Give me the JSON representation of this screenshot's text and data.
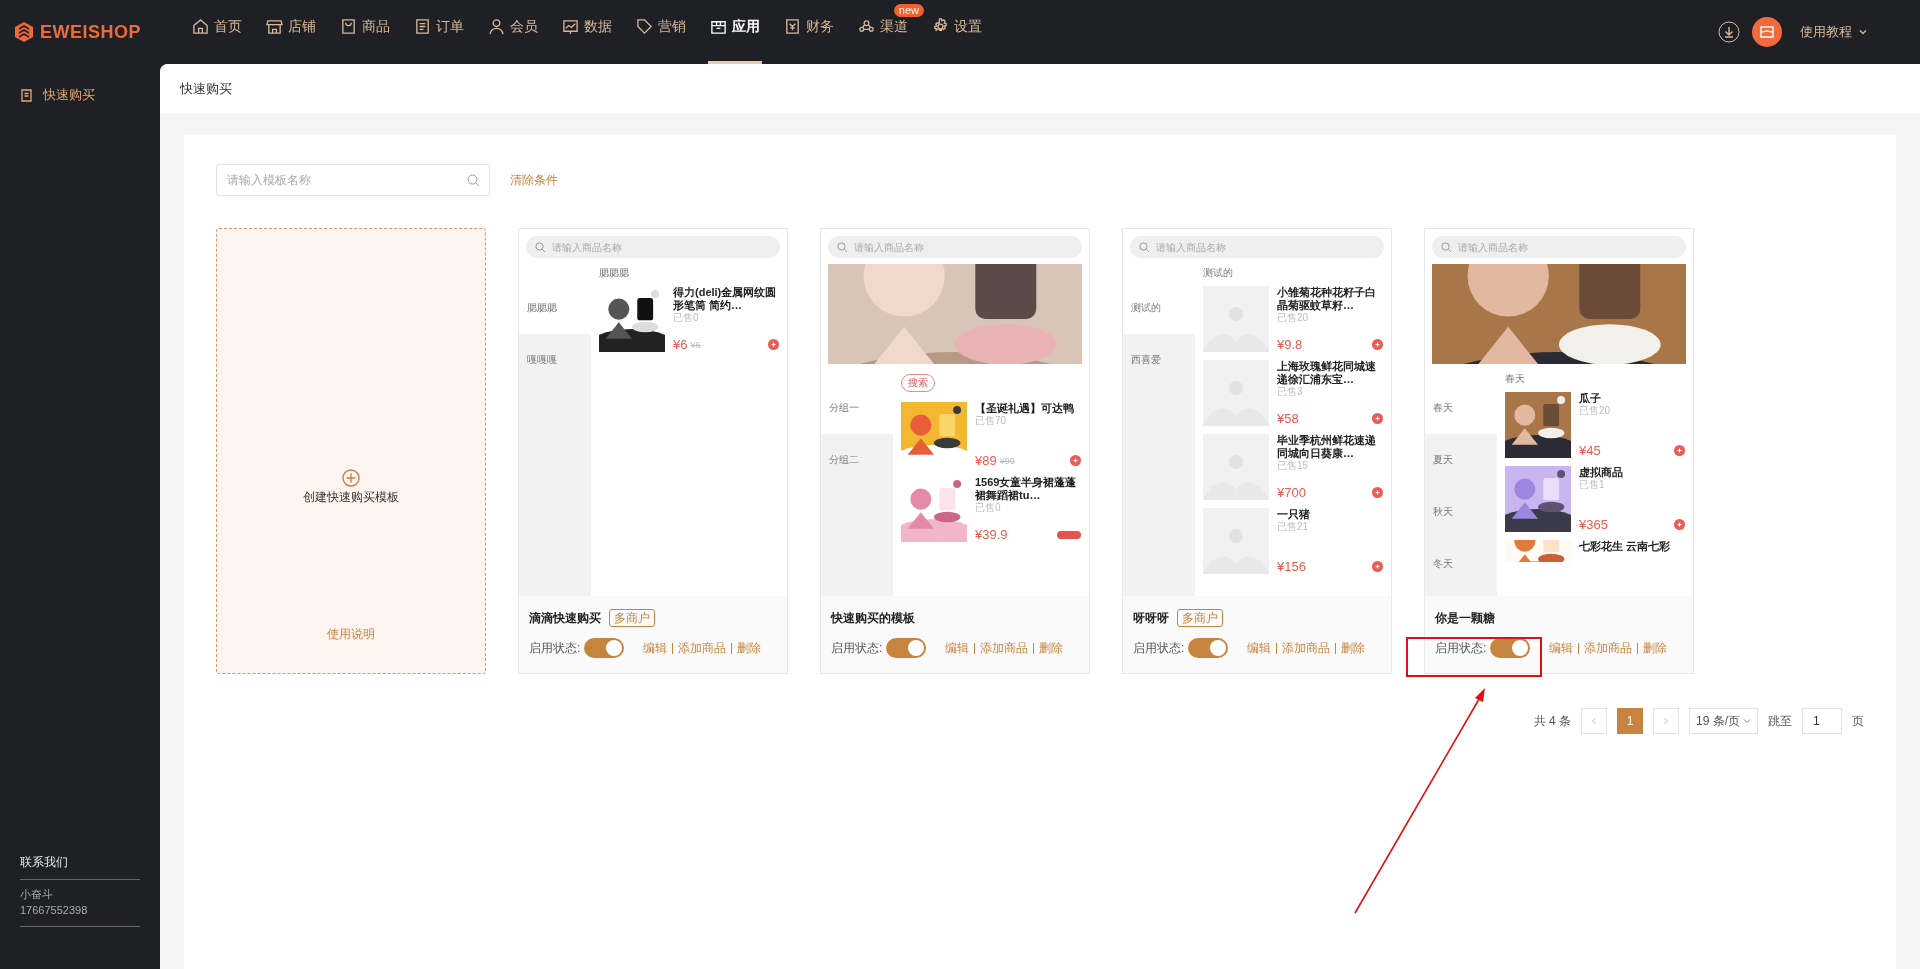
{
  "top_nav": {
    "logo": "EWEISHOP",
    "items": [
      {
        "label": "首页",
        "selected": false
      },
      {
        "label": "店铺",
        "selected": false
      },
      {
        "label": "商品",
        "selected": false
      },
      {
        "label": "订单",
        "selected": false
      },
      {
        "label": "会员",
        "selected": false
      },
      {
        "label": "数据",
        "selected": false
      },
      {
        "label": "营销",
        "selected": false
      },
      {
        "label": "应用",
        "selected": true
      },
      {
        "label": "财务",
        "selected": false
      },
      {
        "label": "渠道",
        "selected": false,
        "badge": "new"
      },
      {
        "label": "设置",
        "selected": false
      }
    ],
    "tutorial": "使用教程"
  },
  "sidebar": {
    "items": [
      {
        "label": "快速购买",
        "selected": true
      }
    ],
    "contact": {
      "title": "联系我们",
      "name": "小奋斗",
      "phone": "17667552398"
    }
  },
  "breadcrumb": "快速购买",
  "filter": {
    "placeholder": "请输入模板名称",
    "clear": "清除条件"
  },
  "create_card": {
    "label": "创建快速购买模板",
    "help": "使用说明"
  },
  "templates": [
    {
      "name": "滴滴快速购买",
      "tag": "多商户",
      "status_label": "启用状态:",
      "enabled": true,
      "actions": [
        "编辑",
        "添加商品",
        "删除"
      ],
      "preview": {
        "search_placeholder": "请输入商品名称",
        "categories": [
          {
            "label": "腮腮腮",
            "selected": true
          },
          {
            "label": "嘎嘎嘎",
            "selected": false
          }
        ],
        "heading": "腮腮腮",
        "products": [
          {
            "name": "得力(deli)金属网纹圆形笔筒 简约…",
            "sold": "已售0",
            "price": "¥6",
            "old_price": "¥6"
          }
        ]
      }
    },
    {
      "name": "快速购买的模板",
      "status_label": "启用状态:",
      "enabled": true,
      "actions": [
        "编辑",
        "添加商品",
        "删除"
      ],
      "preview": {
        "search_placeholder": "请输入商品名称",
        "search_button": "搜索",
        "categories": [
          {
            "label": "分组一",
            "selected": true
          },
          {
            "label": "分组二",
            "selected": false
          }
        ],
        "products": [
          {
            "name": "【圣诞礼遇】可达鸭",
            "sold": "已售70",
            "price": "¥89",
            "old_price": "¥99"
          },
          {
            "kind": "spec",
            "name": "1569女童半身裙蓬蓬裙舞蹈裙tu…",
            "sold": "已售0",
            "price": "¥39.9"
          }
        ]
      }
    },
    {
      "name": "呀呀呀",
      "tag": "多商户",
      "status_label": "启用状态:",
      "enabled": true,
      "actions": [
        "编辑",
        "添加商品",
        "删除"
      ],
      "preview": {
        "search_placeholder": "请输入商品名称",
        "categories": [
          {
            "label": "测试的",
            "selected": true
          },
          {
            "label": "西喜爱",
            "selected": false
          }
        ],
        "heading": "测试的",
        "products": [
          {
            "kind": "blank",
            "name": "小雏菊花种花籽子白晶菊驱蚊草籽…",
            "sold": "已售20",
            "price": "¥9.8"
          },
          {
            "kind": "blank",
            "name": "上海玫瑰鲜花同城速递徐汇浦东宝…",
            "sold": "已售3",
            "price": "¥58"
          },
          {
            "kind": "blank",
            "name": "毕业季杭州鲜花速递同城向日葵康…",
            "sold": "已售15",
            "price": "¥700"
          },
          {
            "kind": "blank",
            "name": "一只猪",
            "sold": "已售21",
            "price": "¥156"
          }
        ]
      }
    },
    {
      "name": "你是一颗糖",
      "status_label": "启用状态:",
      "enabled": true,
      "actions": [
        "编辑",
        "添加商品",
        "删除"
      ],
      "preview": {
        "search_placeholder": "请输入商品名称",
        "categories": [
          {
            "label": "春天",
            "selected": true
          },
          {
            "label": "夏天",
            "selected": false
          },
          {
            "label": "秋天",
            "selected": false
          },
          {
            "label": "冬天",
            "selected": false
          }
        ],
        "heading": "春天",
        "products": [
          {
            "name": "瓜子",
            "sold": "已售20",
            "price": "¥45"
          },
          {
            "name": "虚拟商品",
            "sold": "已售1",
            "price": "¥365"
          },
          {
            "kind": "cut",
            "name": "七彩花生 云南七彩"
          }
        ]
      }
    }
  ],
  "pagination": {
    "total": "共 4 条",
    "pages": [
      {
        "label": "1",
        "selected": true
      }
    ],
    "page_size": "19 条/页",
    "jump_label": "跳至",
    "jump_value": "1",
    "page_suffix": "页"
  }
}
